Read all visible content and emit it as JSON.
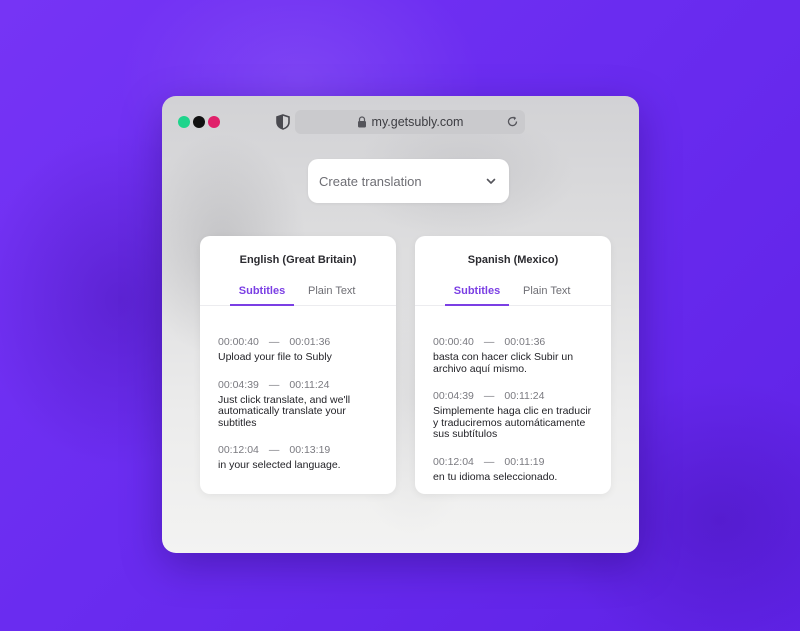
{
  "browser": {
    "window_dots": [
      {
        "color": "#1ed48c",
        "name": "green"
      },
      {
        "color": "#111111",
        "name": "black"
      },
      {
        "color": "#e0206a",
        "name": "pink"
      }
    ],
    "url": "my.getsubly.com",
    "icons": [
      "shield-icon",
      "lock-icon",
      "reload-icon"
    ]
  },
  "translation_select": {
    "value": "Create translation",
    "icon": "chevron-down-icon"
  },
  "cards": [
    {
      "language": "English (Great Britain)",
      "tabs": {
        "active": "Subtitles",
        "inactive": "Plain Text"
      },
      "entries": [
        {
          "start": "00:00:40",
          "end": "00:01:36",
          "text": "Upload your file to Subly"
        },
        {
          "start": "00:04:39",
          "end": "00:11:24",
          "text": "Just click translate, and we'll automatically translate your subtitles"
        },
        {
          "start": "00:12:04",
          "end": "00:13:19",
          "text": "in your selected language."
        }
      ]
    },
    {
      "language": "Spanish (Mexico)",
      "tabs": {
        "active": "Subtitles",
        "inactive": "Plain Text"
      },
      "entries": [
        {
          "start": "00:00:40",
          "end": "00:01:36",
          "text": "basta con hacer click Subir un archivo aquí mismo."
        },
        {
          "start": "00:04:39",
          "end": "00:11:24",
          "text": "Simplemente haga clic en traducir y traduciremos automáticamente sus subtítulos"
        },
        {
          "start": "00:12:04",
          "end": "00:11:19",
          "text": "en tu idioma seleccionado."
        }
      ]
    }
  ],
  "colors": {
    "background": "#6a2cf0",
    "accent": "#7b3fe4"
  }
}
